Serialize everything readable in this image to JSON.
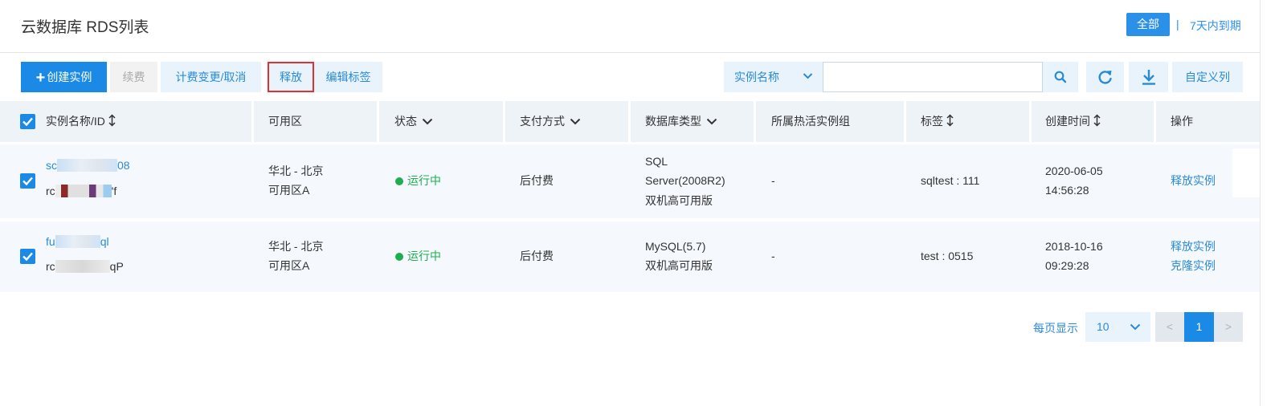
{
  "header": {
    "title": "云数据库 RDS列表",
    "filter_all": "全部",
    "filter_sep": "|",
    "filter_7days": "7天内到期"
  },
  "toolbar": {
    "create_label": "创建实例",
    "renew_label": "续费",
    "change_billing_label": "计费变更/取消",
    "release_label": "释放",
    "edit_tags_label": "编辑标签",
    "search_field": "实例名称",
    "search_value": "",
    "custom_columns_label": "自定义列"
  },
  "table": {
    "columns": [
      "实例名称/ID",
      "可用区",
      "状态",
      "支付方式",
      "数据库类型",
      "所属热活实例组",
      "标签",
      "创建时间",
      "操作"
    ],
    "rows": [
      {
        "name_prefix": "sc",
        "name_suffix": "08",
        "id_prefix": "rc",
        "id_suffix": "'f",
        "zone_line1": "华北 - 北京",
        "zone_line2": "可用区A",
        "status": "运行中",
        "payment": "后付费",
        "db_line1": "SQL",
        "db_line2": "Server(2008R2)",
        "db_line3": "双机高可用版",
        "hot_group": "-",
        "tag": "sqltest : 111",
        "created_date": "2020-06-05",
        "created_time": "14:56:28",
        "action1": "释放实例"
      },
      {
        "name_prefix": "fu",
        "name_suffix": "ql",
        "id_prefix": "rc",
        "id_suffix": "qP",
        "zone_line1": "华北 - 北京",
        "zone_line2": "可用区A",
        "status": "运行中",
        "payment": "后付费",
        "db_line1": "MySQL(5.7)",
        "db_line2": "双机高可用版",
        "hot_group": "-",
        "tag": "test : 0515",
        "created_date": "2018-10-16",
        "created_time": "09:29:28",
        "action1": "释放实例",
        "action2": "克隆实例"
      }
    ]
  },
  "pagination": {
    "page_size_label": "每页显示",
    "page_size": "10",
    "prev": "<",
    "current_page": "1",
    "next": ">"
  },
  "colors": {
    "accent": "#1a8ae6",
    "link": "#2b8ad8",
    "running": "#1fae4f",
    "highlight_border": "#e03030"
  }
}
